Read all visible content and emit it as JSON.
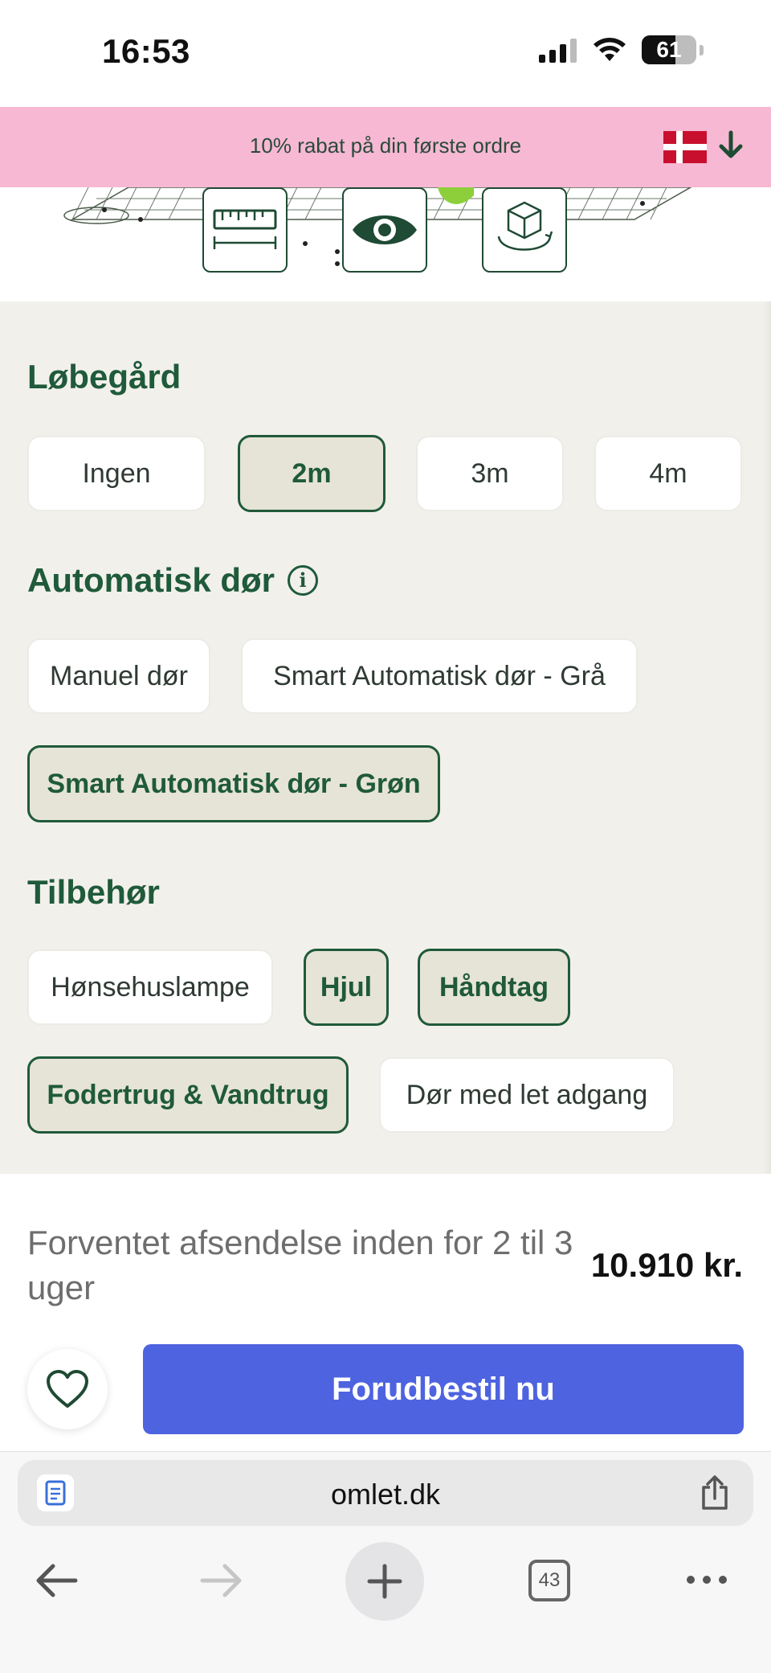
{
  "status_bar": {
    "time": "16:53",
    "battery": "61",
    "icons": [
      "cellular-signal-icon",
      "wifi-icon",
      "battery-icon"
    ]
  },
  "promo": {
    "text": "10% rabat på din første ordre",
    "flag_icon": "denmark-flag-icon",
    "arrow_icon": "arrow-down-icon"
  },
  "hero": {
    "buttons": [
      {
        "icon": "ruler-icon"
      },
      {
        "icon": "eye-icon"
      },
      {
        "icon": "3d-cube-icon"
      }
    ]
  },
  "options": {
    "run": {
      "title": "Løbegård",
      "choices": [
        {
          "label": "Ingen",
          "selected": false
        },
        {
          "label": "2m",
          "selected": true
        },
        {
          "label": "3m",
          "selected": false
        },
        {
          "label": "4m",
          "selected": false
        }
      ]
    },
    "door": {
      "title": "Automatisk dør",
      "info_icon": "info-icon",
      "info_glyph": "i",
      "choices": [
        {
          "label": "Manuel dør",
          "selected": false
        },
        {
          "label": "Smart Automatisk dør - Grå",
          "selected": false
        },
        {
          "label": "Smart Automatisk dør - Grøn",
          "selected": true
        }
      ]
    },
    "accessories": {
      "title": "Tilbehør",
      "choices": [
        {
          "label": "Hønsehuslampe",
          "selected": false
        },
        {
          "label": "Hjul",
          "selected": true
        },
        {
          "label": "Håndtag",
          "selected": true
        },
        {
          "label": "Fodertrug & Vandtrug",
          "selected": true
        },
        {
          "label": "Dør med let adgang",
          "selected": false
        }
      ]
    }
  },
  "purchase": {
    "shipping_text": "Forventet afsendelse inden for 2 til 3 uger",
    "price": "10.910 kr.",
    "favorite_icon": "heart-icon",
    "order_label": "Forudbestil nu"
  },
  "browser": {
    "url": "omlet.dk",
    "tab_count": "43",
    "icons": [
      "reader-icon",
      "share-icon",
      "back-arrow-icon",
      "forward-arrow-icon",
      "new-tab-plus-icon",
      "tabs-icon",
      "more-icon"
    ]
  },
  "colors": {
    "brand_green": "#1f5a3a",
    "promo_pink": "#f7b8d3",
    "order_blue": "#4d63e0",
    "options_bg": "#f2f0eb"
  }
}
